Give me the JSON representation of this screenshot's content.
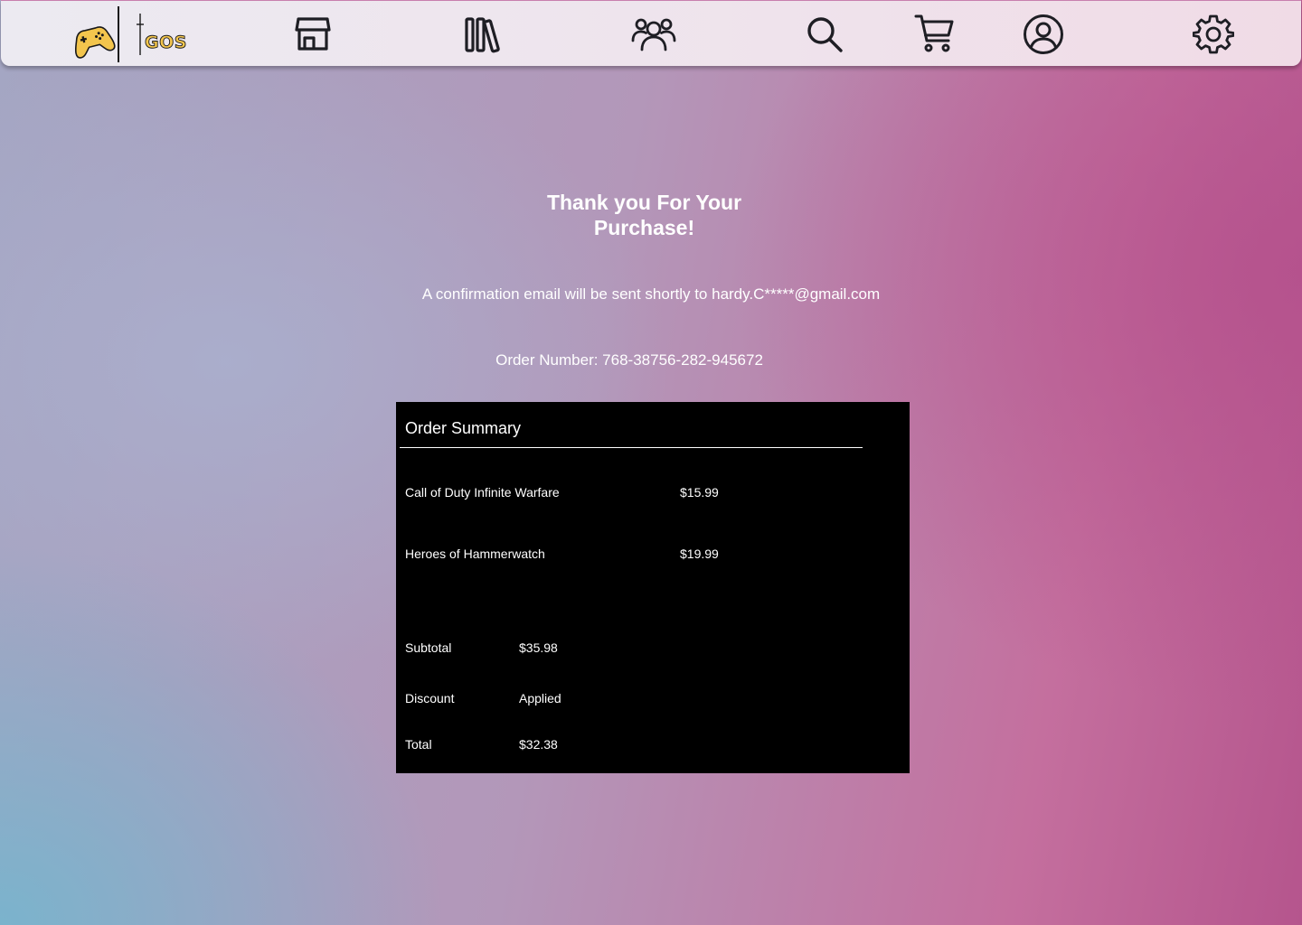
{
  "brand": {
    "logo_text": "GOS",
    "colors": {
      "logo_gold": "#f3c54d",
      "logo_outline": "#1a1a1a",
      "icon_stroke": "#1e1e24"
    }
  },
  "nav": {
    "icons": [
      "store-icon",
      "library-icon",
      "friends-icon",
      "search-icon",
      "cart-icon",
      "profile-icon",
      "settings-icon"
    ]
  },
  "confirmation": {
    "title": "Thank you For Your Purchase!",
    "email_message": "A confirmation email will be sent shortly to hardy.C*****@gmail.com",
    "order_number": "Order Number: 768-38756-282-945672"
  },
  "summary": {
    "title": "Order Summary",
    "items": [
      {
        "name": "Call of Duty Infinite Warfare",
        "price": "$15.99"
      },
      {
        "name": "Heroes of Hammerwatch",
        "price": "$19.99"
      }
    ],
    "totals": {
      "subtotal_label": "Subtotal",
      "subtotal_value": "$35.98",
      "discount_label": "Discount",
      "discount_value": "Applied",
      "total_label": "Total",
      "total_value": "$32.38"
    }
  }
}
